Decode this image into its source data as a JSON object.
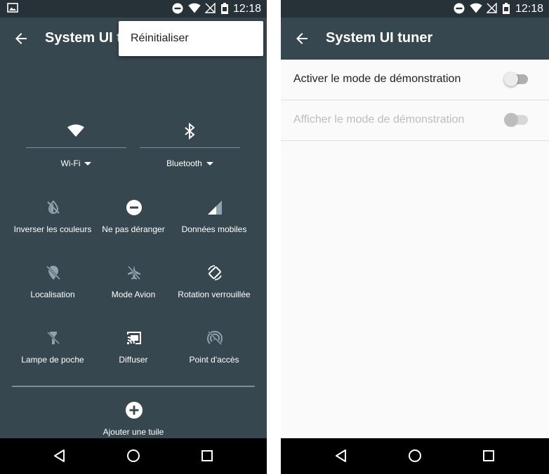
{
  "status_bar": {
    "time": "12:18"
  },
  "left": {
    "toolbar": {
      "title": "System UI t"
    },
    "overflow_menu": {
      "items": [
        "Réinitialiser"
      ]
    },
    "quick_settings": {
      "top": [
        {
          "label": "Wi-Fi",
          "icon": "wifi-icon"
        },
        {
          "label": "Bluetooth",
          "icon": "bluetooth-icon"
        }
      ],
      "tiles": [
        {
          "label": "Inverser les couleurs",
          "icon": "invert-colors-icon"
        },
        {
          "label": "Ne pas déranger",
          "icon": "do-not-disturb-icon"
        },
        {
          "label": "Données mobiles",
          "icon": "mobile-data-icon"
        },
        {
          "label": "Localisation",
          "icon": "location-off-icon"
        },
        {
          "label": "Mode Avion",
          "icon": "airplane-icon"
        },
        {
          "label": "Rotation verrouillée",
          "icon": "rotation-icon"
        },
        {
          "label": "Lampe de poche",
          "icon": "flashlight-icon"
        },
        {
          "label": "Diffuser",
          "icon": "cast-icon"
        },
        {
          "label": "Point d'accès",
          "icon": "hotspot-icon"
        }
      ],
      "add_tile": {
        "label": "Ajouter une tuile",
        "icon": "add-circle-icon"
      }
    }
  },
  "right": {
    "toolbar": {
      "title": "System UI tuner"
    },
    "settings": [
      {
        "label": "Activer le mode de démonstration",
        "enabled": true,
        "checked": false
      },
      {
        "label": "Afficher le mode de démonstration",
        "enabled": false,
        "checked": false
      }
    ]
  },
  "colors": {
    "panel": "#37474f",
    "status_bar": "#263238",
    "settings_bg": "#fafafa",
    "text_primary": "#212121",
    "text_disabled": "#bdbdbd"
  }
}
